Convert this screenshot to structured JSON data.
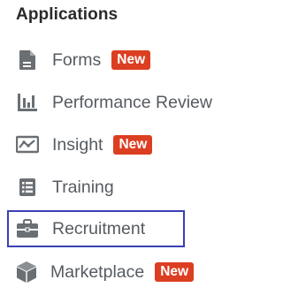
{
  "section": {
    "title": "Applications"
  },
  "items": [
    {
      "label": "Forms",
      "icon": "document-icon",
      "badge": "New"
    },
    {
      "label": "Performance Review",
      "icon": "bar-chart-icon"
    },
    {
      "label": "Insight",
      "icon": "line-chart-icon",
      "badge": "New"
    },
    {
      "label": "Training",
      "icon": "checklist-icon"
    },
    {
      "label": "Recruitment",
      "icon": "briefcase-icon",
      "selected": true
    },
    {
      "label": "Marketplace",
      "icon": "cube-icon",
      "badge": "New"
    }
  ],
  "colors": {
    "icon": "#6a6f74",
    "badge_bg": "#dc3e22",
    "selection_border": "#3a3fb5"
  }
}
